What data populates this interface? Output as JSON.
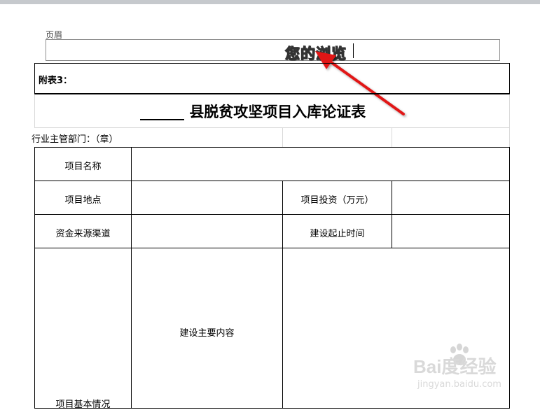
{
  "editor": {
    "header_label": "页眉",
    "header_text": "您的浏览"
  },
  "document": {
    "annex_label": "附表3：",
    "title_blank": "______",
    "title": "县脱贫攻坚项目入库论证表",
    "dept_label": "行业主管部门：（章）"
  },
  "table": {
    "project_name": "项目名称",
    "project_location": "项目地点",
    "project_investment": "项目投资（万元）",
    "fund_source": "资金来源渠道",
    "construction_period": "建设起止时间",
    "main_content": "建设主要内容",
    "basic_info": "项目基本情况"
  },
  "watermark": {
    "brand": "Bai度经验",
    "url": "jingyan.baidu.com"
  },
  "colors": {
    "arrow": "#e11919",
    "border": "#000000",
    "gridline": "#d9d9d9"
  }
}
